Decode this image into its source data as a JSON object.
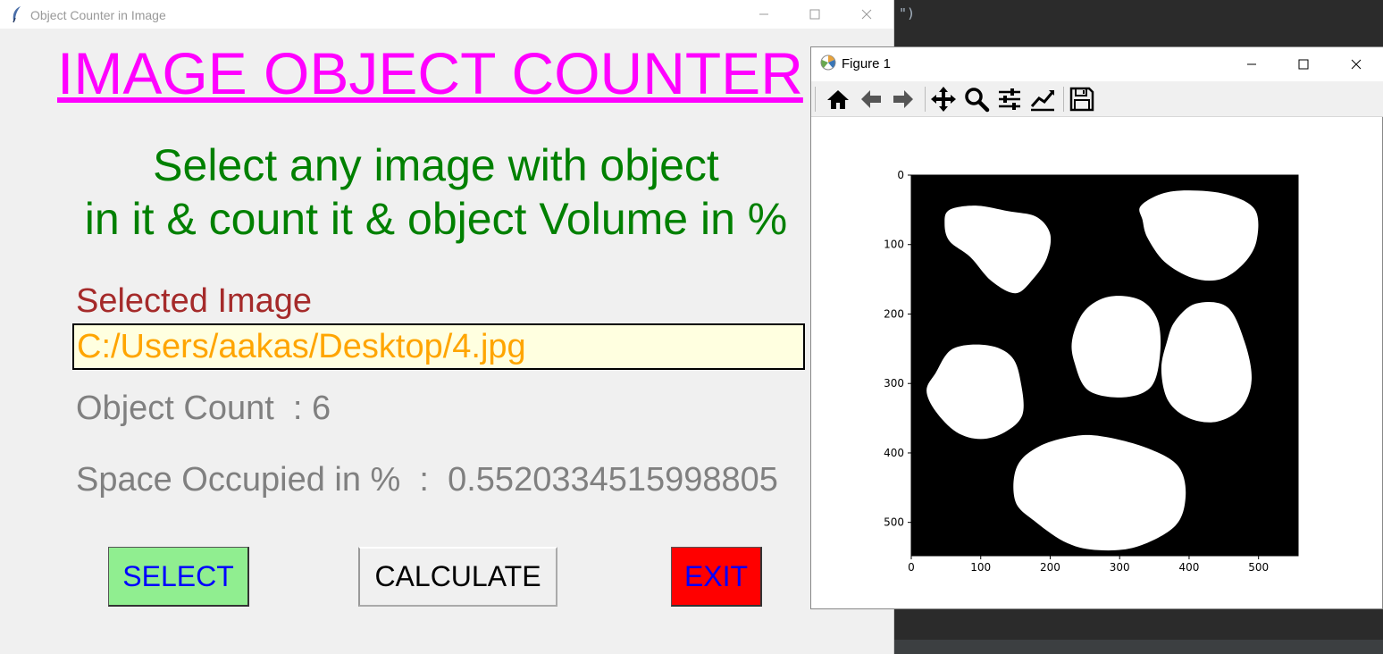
{
  "background_editor": {
    "code_fragment": "\")"
  },
  "main_window": {
    "title": "Object Counter in Image",
    "heading": "IMAGE OBJECT COUNTER",
    "subtitle_line1": "Select any image with object",
    "subtitle_line2": "in it & count it & object Volume in %",
    "selected_label": "Selected Image",
    "selected_path": "C:/Users/aakas/Desktop/4.jpg",
    "object_count_text": "Object Count  : 6",
    "space_text": "Space Occupied in %  :  0.5520334515998805",
    "buttons": {
      "select": "SELECT",
      "calculate": "CALCULATE",
      "exit": "EXIT"
    },
    "colors": {
      "heading": "#ff00ff",
      "subtitle": "#008000",
      "label": "#a52a2a",
      "path": "#ffa500",
      "path_bg": "#ffffe0",
      "info": "#808080",
      "select_bg": "#90ee90",
      "exit_bg": "#ff0000",
      "button_text": "#0000ff"
    }
  },
  "figure_window": {
    "title": "Figure 1",
    "toolbar": [
      "home-icon",
      "back-icon",
      "forward-icon",
      "pan-icon",
      "zoom-icon",
      "configure-subplots-icon",
      "edit-axis-icon",
      "save-icon"
    ]
  },
  "chart_data": {
    "type": "image",
    "xlim": [
      0,
      557
    ],
    "ylim": [
      548,
      0
    ],
    "xticks": [
      0,
      100,
      200,
      300,
      400,
      500
    ],
    "yticks": [
      0,
      100,
      200,
      300,
      400,
      500
    ],
    "xtick_labels": [
      "0",
      "100",
      "200",
      "300",
      "400",
      "500"
    ],
    "ytick_labels": [
      "0",
      "100",
      "200",
      "300",
      "400",
      "500"
    ],
    "background": "#000000",
    "blob_color": "#ffffff",
    "blobs": [
      [
        [
          55,
          50
        ],
        [
          95,
          44
        ],
        [
          140,
          52
        ],
        [
          180,
          60
        ],
        [
          200,
          85
        ],
        [
          195,
          120
        ],
        [
          175,
          150
        ],
        [
          150,
          170
        ],
        [
          115,
          152
        ],
        [
          85,
          118
        ],
        [
          55,
          95
        ],
        [
          48,
          70
        ]
      ],
      [
        [
          330,
          45
        ],
        [
          360,
          27
        ],
        [
          400,
          22
        ],
        [
          455,
          28
        ],
        [
          495,
          50
        ],
        [
          497,
          95
        ],
        [
          478,
          128
        ],
        [
          445,
          150
        ],
        [
          405,
          148
        ],
        [
          365,
          125
        ],
        [
          340,
          90
        ],
        [
          333,
          65
        ]
      ],
      [
        [
          250,
          195
        ],
        [
          285,
          175
        ],
        [
          330,
          180
        ],
        [
          355,
          210
        ],
        [
          358,
          260
        ],
        [
          345,
          305
        ],
        [
          305,
          320
        ],
        [
          255,
          310
        ],
        [
          235,
          270
        ],
        [
          232,
          235
        ]
      ],
      [
        [
          35,
          285
        ],
        [
          60,
          250
        ],
        [
          110,
          245
        ],
        [
          145,
          262
        ],
        [
          158,
          300
        ],
        [
          160,
          345
        ],
        [
          135,
          370
        ],
        [
          100,
          380
        ],
        [
          65,
          370
        ],
        [
          35,
          340
        ],
        [
          22,
          310
        ]
      ],
      [
        [
          380,
          210
        ],
        [
          410,
          185
        ],
        [
          455,
          190
        ],
        [
          480,
          240
        ],
        [
          490,
          295
        ],
        [
          475,
          335
        ],
        [
          440,
          355
        ],
        [
          400,
          350
        ],
        [
          370,
          325
        ],
        [
          360,
          280
        ],
        [
          368,
          240
        ]
      ],
      [
        [
          152,
          420
        ],
        [
          185,
          390
        ],
        [
          240,
          375
        ],
        [
          285,
          378
        ],
        [
          345,
          395
        ],
        [
          385,
          420
        ],
        [
          395,
          462
        ],
        [
          380,
          505
        ],
        [
          325,
          535
        ],
        [
          270,
          540
        ],
        [
          225,
          530
        ],
        [
          180,
          500
        ],
        [
          150,
          470
        ]
      ]
    ]
  }
}
